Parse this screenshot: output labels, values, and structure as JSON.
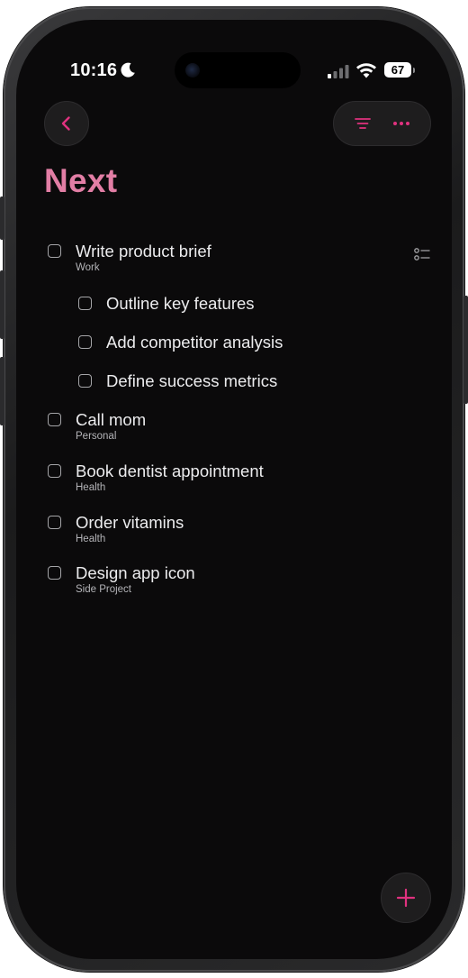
{
  "status_bar": {
    "time": "10:16",
    "battery": "67",
    "icons": [
      "moon-icon",
      "signal-icon",
      "wifi-icon",
      "battery-icon"
    ]
  },
  "toolbar": {
    "back_icon": "chevron-left-icon",
    "filter_icon": "filter-lines-icon",
    "more_icon": "ellipsis-icon"
  },
  "page": {
    "title": "Next"
  },
  "tasks": [
    {
      "title": "Write product brief",
      "tag": "Work",
      "has_checklist": true,
      "subtasks": [
        {
          "title": "Outline key features"
        },
        {
          "title": "Add competitor analysis"
        },
        {
          "title": "Define success metrics"
        }
      ]
    },
    {
      "title": "Call mom",
      "tag": "Personal"
    },
    {
      "title": "Book dentist appointment",
      "tag": "Health"
    },
    {
      "title": "Order vitamins",
      "tag": "Health"
    },
    {
      "title": "Design app icon",
      "tag": "Side Project"
    }
  ],
  "fab": {
    "icon": "plus-icon"
  },
  "colors": {
    "accent": "#e0327f",
    "title": "#e27ea5",
    "background": "#0b0a0b",
    "text": "#ececee",
    "secondary_text": "#b4b4b8"
  }
}
